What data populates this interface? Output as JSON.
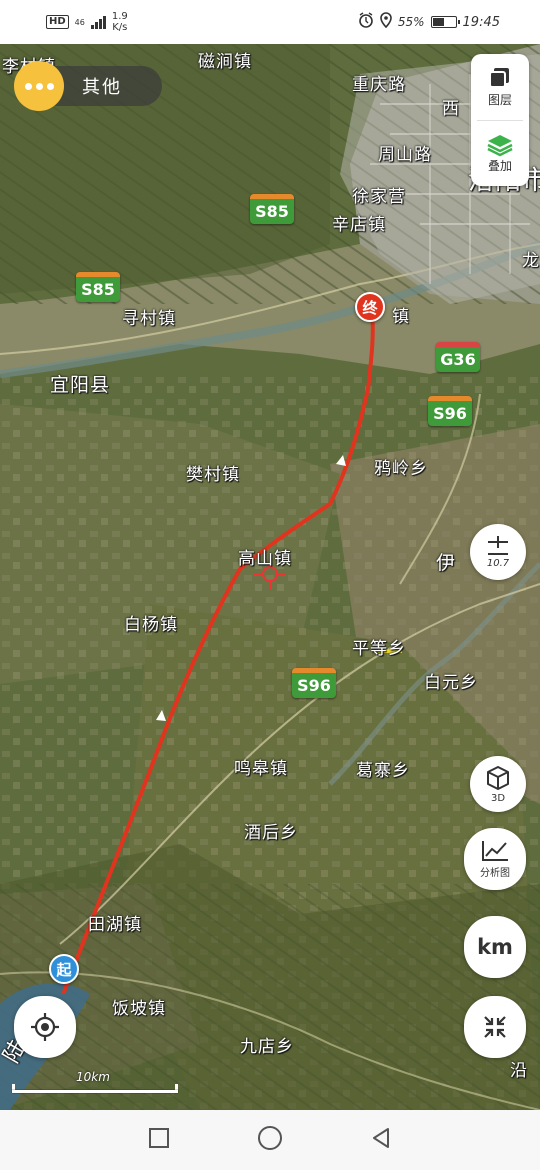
{
  "status_bar": {
    "network_badge": "HD",
    "network_type": "46",
    "speed_value": "1.9",
    "speed_unit": "K/s",
    "battery_percent": "55%",
    "time": "19:45",
    "battery_level": 0.55
  },
  "top_left": {
    "more_icon": "ellipsis-icon",
    "label": "其他"
  },
  "layer_panel": {
    "layers_label": "图层",
    "overlay_label": "叠加"
  },
  "controls": {
    "zoom_level": "10.7",
    "view_3d_label": "3D",
    "analysis_label": "分析图",
    "unit_label": "km"
  },
  "route": {
    "start_label": "起",
    "end_label": "终",
    "line_color": "#e0341e"
  },
  "scale_bar": {
    "label": "10km"
  },
  "places": {
    "cijian": "磁涧镇",
    "chongqing_rd": "重庆路",
    "xi": "西",
    "zhoushan_rd": "周山路",
    "xujiaying": "徐家营",
    "xindian": "辛店镇",
    "luoyang": "洛阳市",
    "long": "龙",
    "licun": "李村镇",
    "xuncun": "寻村镇",
    "yiyang": "宜阳县",
    "fancun": "樊村镇",
    "yaling": "鸦岭乡",
    "gaoshan": "高山镇",
    "baiyang": "白杨镇",
    "pingdeng": "平等乡",
    "baiyuan": "白元乡",
    "minggao": "鸣皋镇",
    "gezhai": "葛寨乡",
    "jiuhou": "酒后乡",
    "tianhu": "田湖镇",
    "fanpo": "饭坡镇",
    "jiudian": "九店乡",
    "lu": "陆",
    "yan": "沿",
    "jizhen": "镇",
    "yi": "伊"
  },
  "shields": {
    "s85_a": "S85",
    "s85_b": "S85",
    "g36": "G36",
    "s96_a": "S96",
    "s96_b": "S96"
  }
}
